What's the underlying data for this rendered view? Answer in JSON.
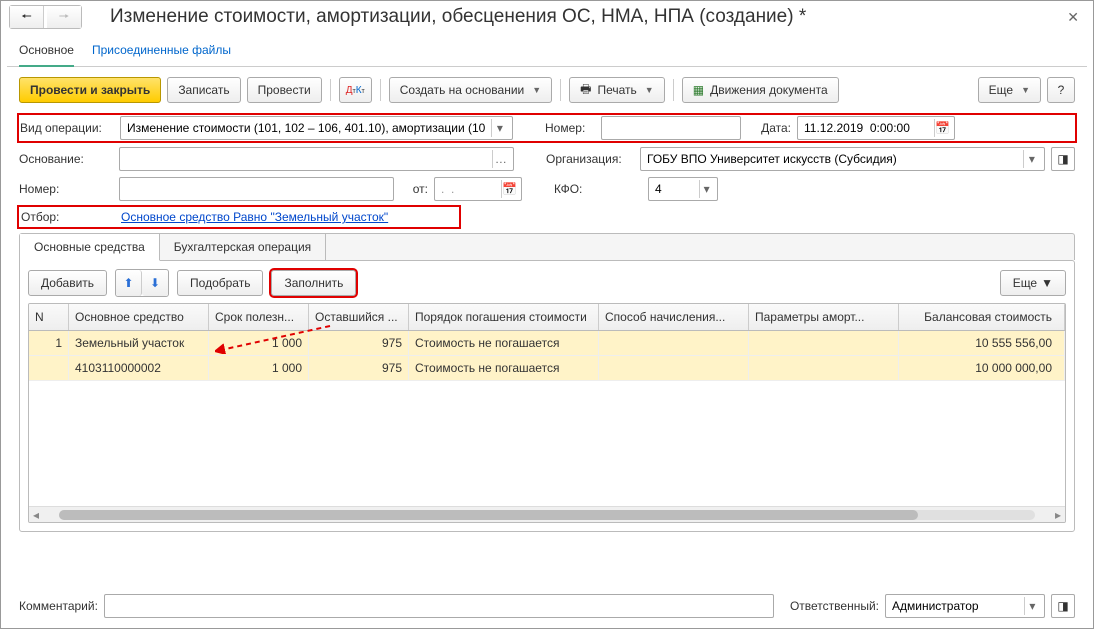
{
  "title": "Изменение стоимости, амортизации, обесценения ОС, НМА, НПА (создание) *",
  "nav_tabs": {
    "main": "Основное",
    "files": "Присоединенные файлы"
  },
  "toolbar": {
    "post_close": "Провести и закрыть",
    "save": "Записать",
    "post": "Провести",
    "create_based": "Создать на основании",
    "print": "Печать",
    "movements": "Движения документа",
    "more": "Еще",
    "help": "?"
  },
  "form": {
    "op_type_label": "Вид операции:",
    "op_type_value": "Изменение стоимости (101, 102 – 106, 401.10), амортизации (10",
    "number_label": "Номер:",
    "number_value": "",
    "date_label": "Дата:",
    "date_value": "11.12.2019  0:00:00",
    "basis_label": "Основание:",
    "basis_value": "",
    "org_label": "Организация:",
    "org_value": "ГОБУ ВПО Университет искусств (Субсидия)",
    "doc_number_label": "Номер:",
    "doc_number_value": "",
    "from_label": "от:",
    "from_value": ".  .",
    "kfo_label": "КФО:",
    "kfo_value": "4",
    "filter_label": "Отбор:",
    "filter_value": "Основное средство Равно \"Земельный участок\""
  },
  "tabs2": {
    "assets": "Основные средства",
    "acc_op": "Бухгалтерская операция"
  },
  "panel_toolbar": {
    "add": "Добавить",
    "pick": "Подобрать",
    "fill": "Заполнить",
    "more": "Еще"
  },
  "grid": {
    "headers": {
      "n": "N",
      "os": "Основное средство",
      "srok": "Срок полезн...",
      "ost": "Оставшийся ...",
      "por": "Порядок погашения стоимости",
      "sposob": "Способ начисления...",
      "param": "Параметры аморт...",
      "bal": "Балансовая стоимость"
    },
    "rows": [
      {
        "n": "1",
        "os": "Земельный участок",
        "srok": "1 000",
        "ost": "975",
        "por": "Стоимость не погашается",
        "sposob": "",
        "param": "",
        "bal": "10 555 556,00"
      },
      {
        "n": "",
        "os": "4103110000002",
        "srok": "1 000",
        "ost": "975",
        "por": "Стоимость не погашается",
        "sposob": "",
        "param": "",
        "bal": "10 000 000,00"
      }
    ]
  },
  "footer": {
    "comment_label": "Комментарий:",
    "comment_value": "",
    "resp_label": "Ответственный:",
    "resp_value": "Администратор"
  }
}
